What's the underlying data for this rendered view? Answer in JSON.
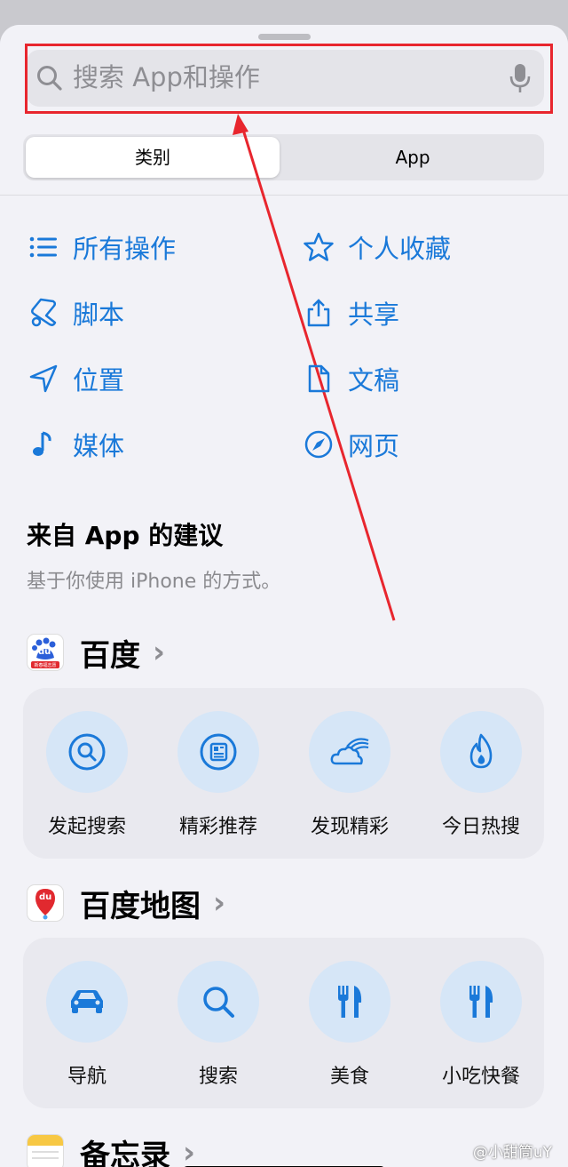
{
  "search": {
    "placeholder": "搜索 App和操作"
  },
  "segments": {
    "left": "类别",
    "right": "App"
  },
  "categories": [
    {
      "label": "所有操作",
      "icon": "list-icon"
    },
    {
      "label": "个人收藏",
      "icon": "star-icon"
    },
    {
      "label": "脚本",
      "icon": "script-icon"
    },
    {
      "label": "共享",
      "icon": "share-icon"
    },
    {
      "label": "位置",
      "icon": "location-arrow-icon"
    },
    {
      "label": "文稿",
      "icon": "document-icon"
    },
    {
      "label": "媒体",
      "icon": "music-note-icon"
    },
    {
      "label": "网页",
      "icon": "compass-icon"
    }
  ],
  "suggestions": {
    "title": "来自 App 的建议",
    "subtitle": "基于你使用 iPhone 的方式。"
  },
  "apps": [
    {
      "name": "百度",
      "icon_badge": "du",
      "icon_caption": "新春福志愿",
      "actions": [
        {
          "label": "发起搜索",
          "icon": "search-circle-icon"
        },
        {
          "label": "精彩推荐",
          "icon": "news-icon"
        },
        {
          "label": "发现精彩",
          "icon": "cloud-rainbow-icon"
        },
        {
          "label": "今日热搜",
          "icon": "flame-icon"
        }
      ]
    },
    {
      "name": "百度地图",
      "icon_badge": "du",
      "actions": [
        {
          "label": "导航",
          "icon": "car-icon"
        },
        {
          "label": "搜索",
          "icon": "magnifier-icon"
        },
        {
          "label": "美食",
          "icon": "fork-knife-icon"
        },
        {
          "label": "小吃快餐",
          "icon": "fork-knife-icon"
        }
      ]
    },
    {
      "name": "备忘录"
    }
  ],
  "watermark": "@小甜筒uY",
  "colors": {
    "accent": "#1a79d9",
    "highlight": "#e8262e",
    "baidu_red": "#e1292f",
    "baidu_blue": "#2b5fd9"
  }
}
